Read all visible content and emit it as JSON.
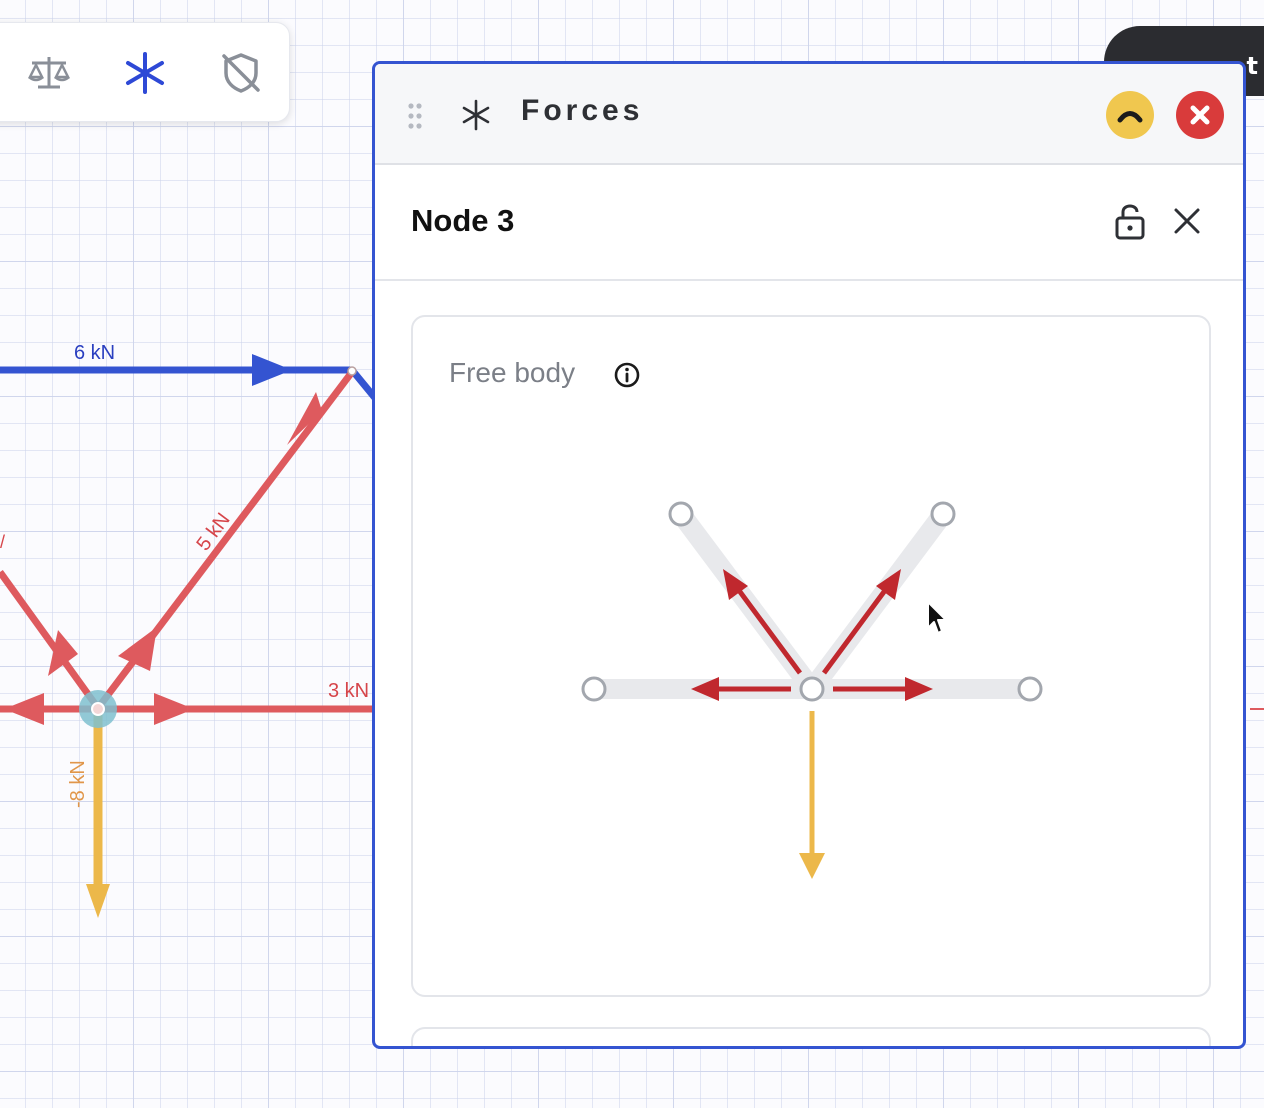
{
  "canvas": {
    "labels": {
      "top_member": "6 kN",
      "diagonal_member": "5 kN",
      "bottom_member": "3 kN",
      "vertical_load": "-8 kN"
    },
    "colors": {
      "compression_blue": "#3454d1",
      "tension_red": "#de5a5e",
      "load_yellow": "#ecb84a",
      "selected_node": "#7fc0cf"
    }
  },
  "toolbar": {
    "tools": [
      {
        "icon": "balance-scale-icon",
        "active": false
      },
      {
        "icon": "asterisk-forces-icon",
        "active": true
      },
      {
        "icon": "shield-off-icon",
        "active": false
      }
    ]
  },
  "panel": {
    "title": "Forces",
    "icon": "asterisk-icon",
    "minimize_icon": "chevron-up-icon",
    "close_icon": "close-icon"
  },
  "node": {
    "title": "Node 3",
    "lock_icon": "unlock-icon",
    "close_icon": "x-icon"
  },
  "free_body": {
    "title": "Free body",
    "info_icon": "info-icon",
    "members_at_node": [
      "left",
      "upper-left",
      "upper-right",
      "right"
    ],
    "external_load": "down",
    "colors": {
      "member": "#e8e9ec",
      "force": "#c0282e",
      "load": "#ecb84a",
      "node": "#a3a7ae"
    }
  },
  "dark_tab": {
    "text": "t"
  }
}
